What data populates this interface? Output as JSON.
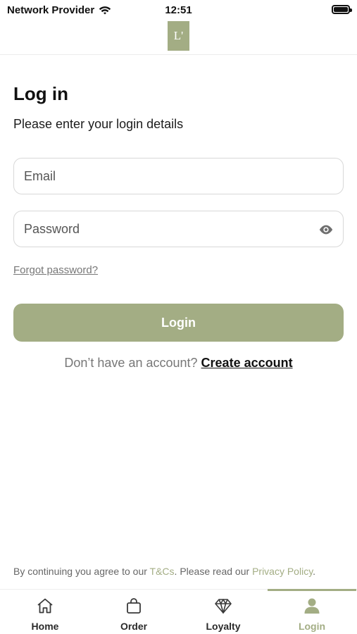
{
  "status_bar": {
    "carrier": "Network Provider",
    "time": "12:51"
  },
  "header": {
    "logo_text": "L'"
  },
  "login": {
    "title": "Log in",
    "subtitle": "Please enter your login details",
    "email_placeholder": "Email",
    "password_placeholder": "Password",
    "forgot_password": "Forgot password?",
    "login_button": "Login",
    "no_account_text": "Don’t have an account?",
    "create_account": "Create account"
  },
  "terms": {
    "prefix": "By continuing you agree to our ",
    "tcs": "T&Cs",
    "middle": ". Please read our ",
    "privacy": "Privacy Policy",
    "suffix": "."
  },
  "tabbar": {
    "items": [
      {
        "label": "Home",
        "icon": "home-icon"
      },
      {
        "label": "Order",
        "icon": "bag-icon"
      },
      {
        "label": "Loyalty",
        "icon": "diamond-icon"
      },
      {
        "label": "Login",
        "icon": "person-icon",
        "active": true
      }
    ]
  },
  "colors": {
    "accent": "#a3ad84",
    "text": "#111111",
    "muted": "#777777"
  }
}
